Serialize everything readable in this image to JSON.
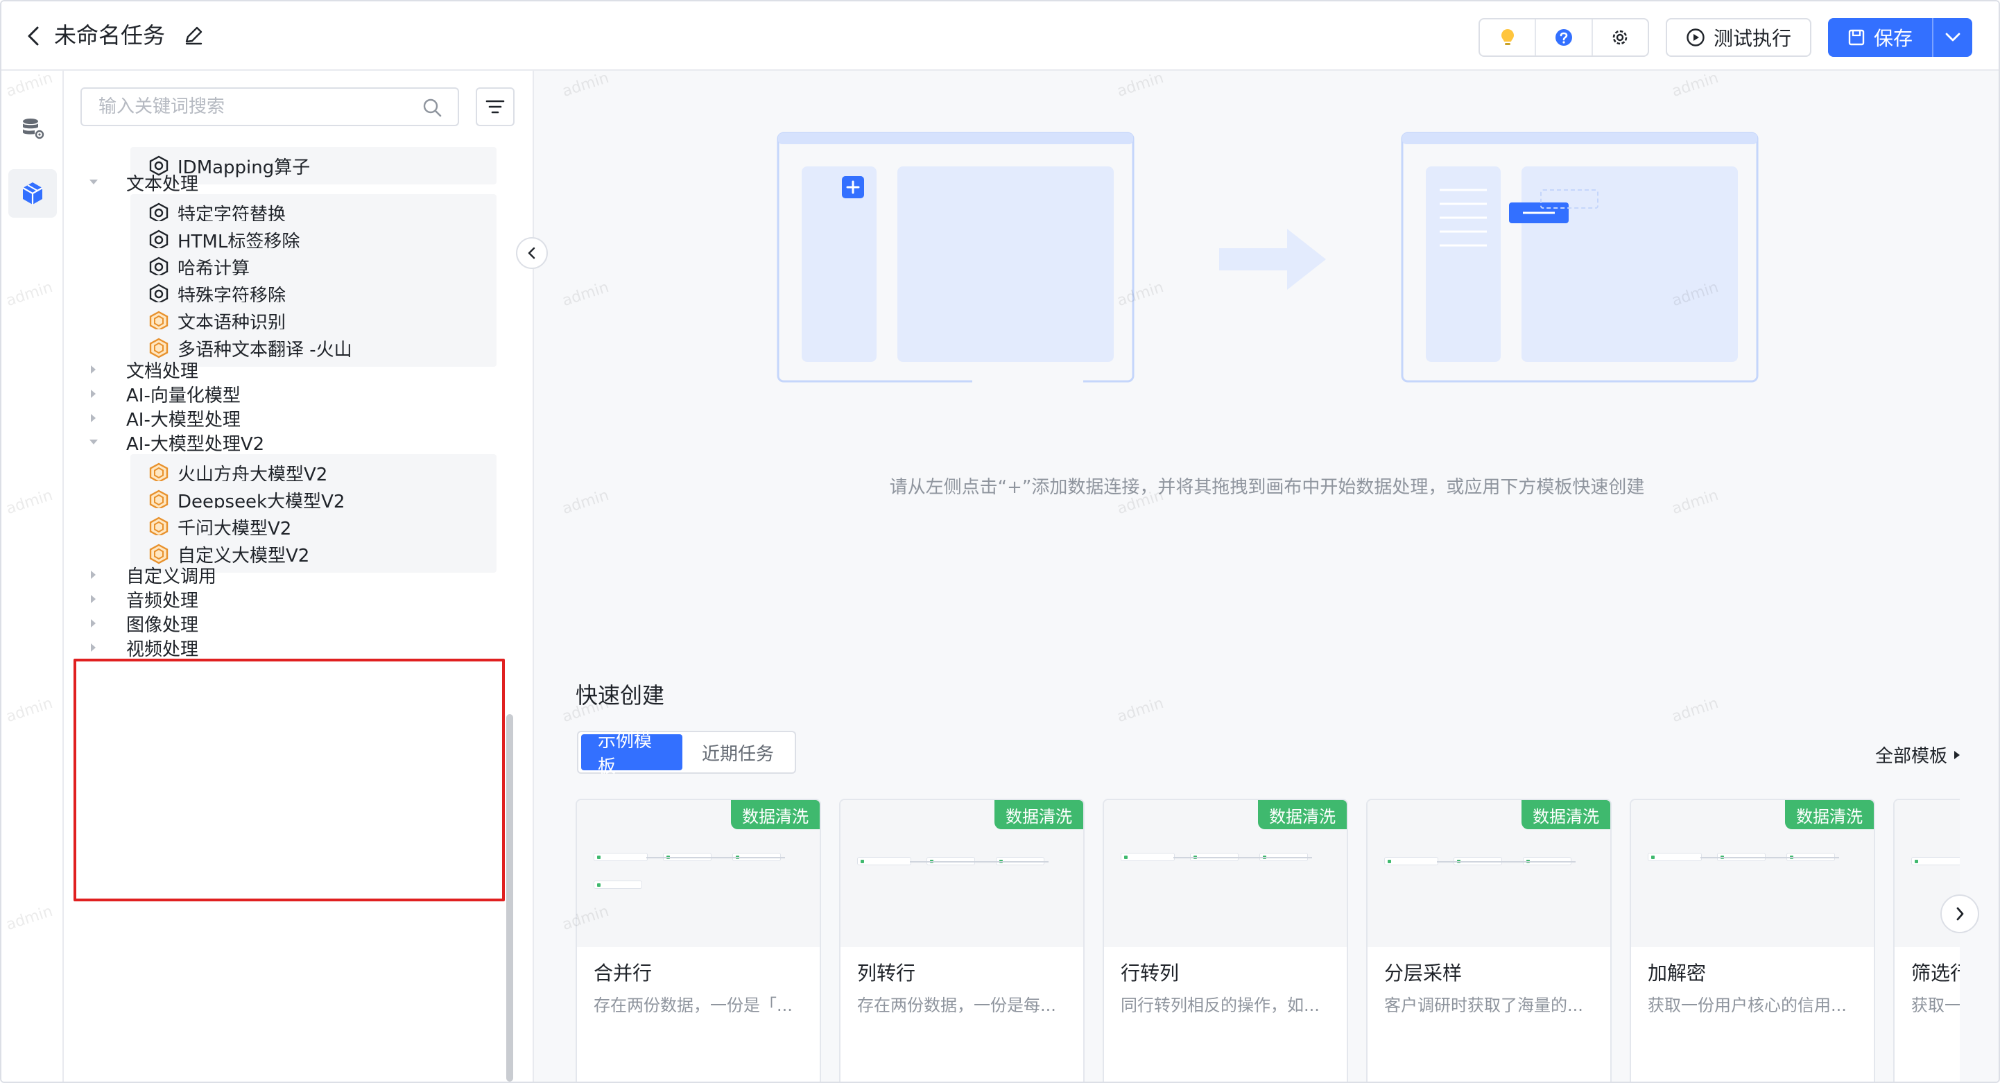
{
  "header": {
    "title": "未命名任务",
    "test_run_label": "测试执行",
    "save_label": "保存"
  },
  "panel": {
    "search_placeholder": "输入关键词搜索",
    "tree": [
      {
        "kind": "op",
        "label": "IDMapping算子",
        "icon": "cube-gear-icon"
      },
      {
        "kind": "cat",
        "label": "文本处理",
        "expanded": true
      },
      {
        "kind": "op",
        "label": "特定字符替换",
        "icon": "cube-gear-icon"
      },
      {
        "kind": "op",
        "label": "HTML标签移除",
        "icon": "cube-gear-icon"
      },
      {
        "kind": "op",
        "label": "哈希计算",
        "icon": "cube-gear-icon"
      },
      {
        "kind": "op",
        "label": "特殊字符移除",
        "icon": "cube-gear-icon"
      },
      {
        "kind": "op",
        "label": "文本语种识别",
        "icon": "hexagon-ai-icon"
      },
      {
        "kind": "op",
        "label": "多语种文本翻译 -火山",
        "icon": "hexagon-ai-icon"
      },
      {
        "kind": "cat",
        "label": "文档处理",
        "expanded": false
      },
      {
        "kind": "cat",
        "label": "AI-向量化模型",
        "expanded": false
      },
      {
        "kind": "cat",
        "label": "AI-大模型处理",
        "expanded": false
      },
      {
        "kind": "cat",
        "label": "AI-大模型处理V2",
        "expanded": true
      },
      {
        "kind": "op",
        "label": "火山方舟大模型V2",
        "icon": "hexagon-ai-icon"
      },
      {
        "kind": "op",
        "label": "Deepseek大模型V2",
        "icon": "hexagon-ai-icon"
      },
      {
        "kind": "op",
        "label": "千问大模型V2",
        "icon": "hexagon-ai-icon"
      },
      {
        "kind": "op",
        "label": "自定义大模型V2",
        "icon": "hexagon-ai-icon"
      },
      {
        "kind": "cat",
        "label": "自定义调用",
        "expanded": false
      },
      {
        "kind": "cat",
        "label": "音频处理",
        "expanded": false
      },
      {
        "kind": "cat",
        "label": "图像处理",
        "expanded": false
      },
      {
        "kind": "cat",
        "label": "视频处理",
        "expanded": false
      }
    ]
  },
  "canvas": {
    "hint": "请从左侧点击“+”添加数据连接，并将其拖拽到画布中开始数据处理，或应用下方模板快速创建",
    "quick_create_title": "快速创建",
    "tabs": [
      {
        "label": "示例模板",
        "active": true
      },
      {
        "label": "近期任务",
        "active": false
      }
    ],
    "all_templates_label": "全部模板",
    "cards": [
      {
        "tag": "数据清洗",
        "title": "合并行",
        "desc": "存在两份数据，一份是「..."
      },
      {
        "tag": "数据清洗",
        "title": "列转行",
        "desc": "存在两份数据，一份是每..."
      },
      {
        "tag": "数据清洗",
        "title": "行转列",
        "desc": "同行转列相反的操作，如..."
      },
      {
        "tag": "数据清洗",
        "title": "分层采样",
        "desc": "客户调研时获取了海量的..."
      },
      {
        "tag": "数据清洗",
        "title": "加解密",
        "desc": "获取一份用户核心的信用..."
      },
      {
        "tag": "",
        "title": "筛选行",
        "desc": "获取一"
      }
    ]
  },
  "watermark": "admin",
  "colors": {
    "primary": "#3370ff",
    "tag_green": "#3fb96e",
    "highlight_red": "#e02020"
  }
}
